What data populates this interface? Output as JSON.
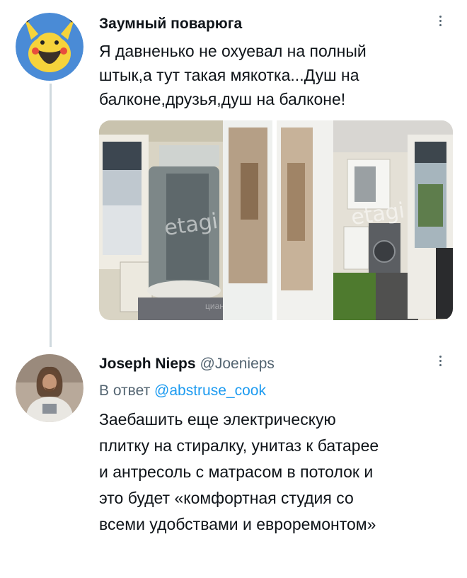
{
  "tweet1": {
    "author_name": "Заумный поварюга",
    "text": "Я давненько не охуевал на полный\nштык,а тут такая мякотка...Душ на\nбалконе,друзья,душ на балконе!",
    "media": {
      "left_watermark": "etagi",
      "left_watermark_small": "циан",
      "right_watermark": "etagi"
    }
  },
  "tweet2": {
    "author_name": "Joseph Nieps",
    "handle": "@Joenieps",
    "reply_prefix": "В ответ",
    "reply_handle": "@abstruse_cook",
    "text": "Заебашить еще электрическую\nплитку на стиралку, унитаз к батарее\nи антресоль с матрасом в потолок и\nэто будет «комфортная студия со\nвсеми удобствами и евроремонтом»"
  },
  "colors": {
    "text": "#0f1419",
    "secondary": "#536471",
    "link": "#1d9bf0",
    "thread_line": "#cfd9de"
  },
  "icons": {
    "more": "vertical-dots-icon",
    "avatar1": "pikachu-beard-avatar",
    "avatar2": "astronaut-avatar"
  }
}
